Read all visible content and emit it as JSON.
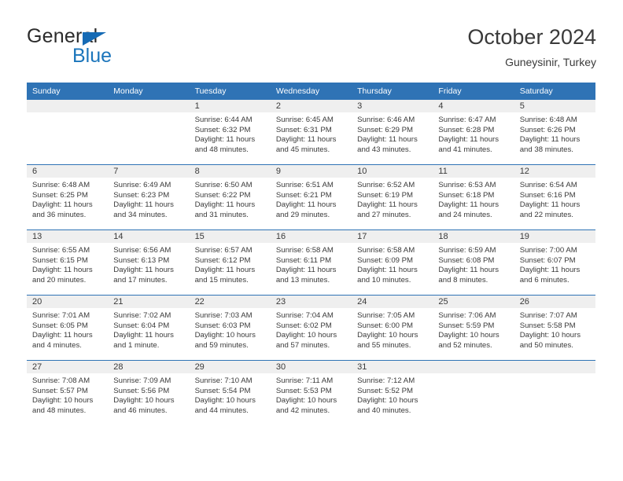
{
  "brand": {
    "name_top": "General",
    "name_bottom": "Blue",
    "triangle_color": "#166bb5",
    "blue_color": "#1b75bb"
  },
  "header": {
    "title": "October 2024",
    "location": "Guneysinir, Turkey"
  },
  "theme": {
    "header_blue": "#2f73b5",
    "daynum_band": "#efefef",
    "text": "#3a3a3a"
  },
  "calendar": {
    "weekday_headers": [
      "Sunday",
      "Monday",
      "Tuesday",
      "Wednesday",
      "Thursday",
      "Friday",
      "Saturday"
    ],
    "weeks": [
      [
        {
          "day": "",
          "sunrise": "",
          "sunset": "",
          "daylight": ""
        },
        {
          "day": "",
          "sunrise": "",
          "sunset": "",
          "daylight": ""
        },
        {
          "day": "1",
          "sunrise": "Sunrise: 6:44 AM",
          "sunset": "Sunset: 6:32 PM",
          "daylight": "Daylight: 11 hours and 48 minutes."
        },
        {
          "day": "2",
          "sunrise": "Sunrise: 6:45 AM",
          "sunset": "Sunset: 6:31 PM",
          "daylight": "Daylight: 11 hours and 45 minutes."
        },
        {
          "day": "3",
          "sunrise": "Sunrise: 6:46 AM",
          "sunset": "Sunset: 6:29 PM",
          "daylight": "Daylight: 11 hours and 43 minutes."
        },
        {
          "day": "4",
          "sunrise": "Sunrise: 6:47 AM",
          "sunset": "Sunset: 6:28 PM",
          "daylight": "Daylight: 11 hours and 41 minutes."
        },
        {
          "day": "5",
          "sunrise": "Sunrise: 6:48 AM",
          "sunset": "Sunset: 6:26 PM",
          "daylight": "Daylight: 11 hours and 38 minutes."
        }
      ],
      [
        {
          "day": "6",
          "sunrise": "Sunrise: 6:48 AM",
          "sunset": "Sunset: 6:25 PM",
          "daylight": "Daylight: 11 hours and 36 minutes."
        },
        {
          "day": "7",
          "sunrise": "Sunrise: 6:49 AM",
          "sunset": "Sunset: 6:23 PM",
          "daylight": "Daylight: 11 hours and 34 minutes."
        },
        {
          "day": "8",
          "sunrise": "Sunrise: 6:50 AM",
          "sunset": "Sunset: 6:22 PM",
          "daylight": "Daylight: 11 hours and 31 minutes."
        },
        {
          "day": "9",
          "sunrise": "Sunrise: 6:51 AM",
          "sunset": "Sunset: 6:21 PM",
          "daylight": "Daylight: 11 hours and 29 minutes."
        },
        {
          "day": "10",
          "sunrise": "Sunrise: 6:52 AM",
          "sunset": "Sunset: 6:19 PM",
          "daylight": "Daylight: 11 hours and 27 minutes."
        },
        {
          "day": "11",
          "sunrise": "Sunrise: 6:53 AM",
          "sunset": "Sunset: 6:18 PM",
          "daylight": "Daylight: 11 hours and 24 minutes."
        },
        {
          "day": "12",
          "sunrise": "Sunrise: 6:54 AM",
          "sunset": "Sunset: 6:16 PM",
          "daylight": "Daylight: 11 hours and 22 minutes."
        }
      ],
      [
        {
          "day": "13",
          "sunrise": "Sunrise: 6:55 AM",
          "sunset": "Sunset: 6:15 PM",
          "daylight": "Daylight: 11 hours and 20 minutes."
        },
        {
          "day": "14",
          "sunrise": "Sunrise: 6:56 AM",
          "sunset": "Sunset: 6:13 PM",
          "daylight": "Daylight: 11 hours and 17 minutes."
        },
        {
          "day": "15",
          "sunrise": "Sunrise: 6:57 AM",
          "sunset": "Sunset: 6:12 PM",
          "daylight": "Daylight: 11 hours and 15 minutes."
        },
        {
          "day": "16",
          "sunrise": "Sunrise: 6:58 AM",
          "sunset": "Sunset: 6:11 PM",
          "daylight": "Daylight: 11 hours and 13 minutes."
        },
        {
          "day": "17",
          "sunrise": "Sunrise: 6:58 AM",
          "sunset": "Sunset: 6:09 PM",
          "daylight": "Daylight: 11 hours and 10 minutes."
        },
        {
          "day": "18",
          "sunrise": "Sunrise: 6:59 AM",
          "sunset": "Sunset: 6:08 PM",
          "daylight": "Daylight: 11 hours and 8 minutes."
        },
        {
          "day": "19",
          "sunrise": "Sunrise: 7:00 AM",
          "sunset": "Sunset: 6:07 PM",
          "daylight": "Daylight: 11 hours and 6 minutes."
        }
      ],
      [
        {
          "day": "20",
          "sunrise": "Sunrise: 7:01 AM",
          "sunset": "Sunset: 6:05 PM",
          "daylight": "Daylight: 11 hours and 4 minutes."
        },
        {
          "day": "21",
          "sunrise": "Sunrise: 7:02 AM",
          "sunset": "Sunset: 6:04 PM",
          "daylight": "Daylight: 11 hours and 1 minute."
        },
        {
          "day": "22",
          "sunrise": "Sunrise: 7:03 AM",
          "sunset": "Sunset: 6:03 PM",
          "daylight": "Daylight: 10 hours and 59 minutes."
        },
        {
          "day": "23",
          "sunrise": "Sunrise: 7:04 AM",
          "sunset": "Sunset: 6:02 PM",
          "daylight": "Daylight: 10 hours and 57 minutes."
        },
        {
          "day": "24",
          "sunrise": "Sunrise: 7:05 AM",
          "sunset": "Sunset: 6:00 PM",
          "daylight": "Daylight: 10 hours and 55 minutes."
        },
        {
          "day": "25",
          "sunrise": "Sunrise: 7:06 AM",
          "sunset": "Sunset: 5:59 PM",
          "daylight": "Daylight: 10 hours and 52 minutes."
        },
        {
          "day": "26",
          "sunrise": "Sunrise: 7:07 AM",
          "sunset": "Sunset: 5:58 PM",
          "daylight": "Daylight: 10 hours and 50 minutes."
        }
      ],
      [
        {
          "day": "27",
          "sunrise": "Sunrise: 7:08 AM",
          "sunset": "Sunset: 5:57 PM",
          "daylight": "Daylight: 10 hours and 48 minutes."
        },
        {
          "day": "28",
          "sunrise": "Sunrise: 7:09 AM",
          "sunset": "Sunset: 5:56 PM",
          "daylight": "Daylight: 10 hours and 46 minutes."
        },
        {
          "day": "29",
          "sunrise": "Sunrise: 7:10 AM",
          "sunset": "Sunset: 5:54 PM",
          "daylight": "Daylight: 10 hours and 44 minutes."
        },
        {
          "day": "30",
          "sunrise": "Sunrise: 7:11 AM",
          "sunset": "Sunset: 5:53 PM",
          "daylight": "Daylight: 10 hours and 42 minutes."
        },
        {
          "day": "31",
          "sunrise": "Sunrise: 7:12 AM",
          "sunset": "Sunset: 5:52 PM",
          "daylight": "Daylight: 10 hours and 40 minutes."
        },
        {
          "day": "",
          "sunrise": "",
          "sunset": "",
          "daylight": ""
        },
        {
          "day": "",
          "sunrise": "",
          "sunset": "",
          "daylight": ""
        }
      ]
    ]
  }
}
